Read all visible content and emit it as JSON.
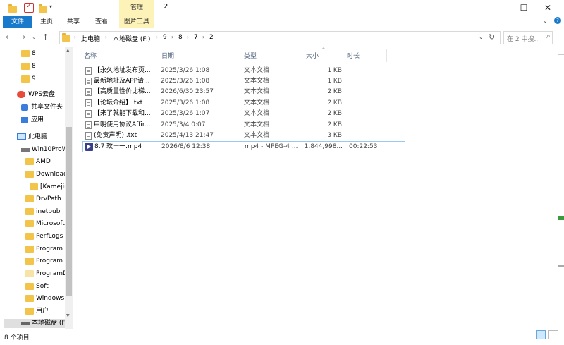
{
  "title": {
    "context_tab": "管理",
    "window_title": "2"
  },
  "window_controls": {
    "minimize": "—",
    "maximize": "☐",
    "close": "✕"
  },
  "ribbon": {
    "tabs": [
      "文件",
      "主页",
      "共享",
      "查看",
      "图片工具"
    ]
  },
  "address": {
    "crumbs": [
      "此电脑",
      "本地磁盘 (F:)",
      "9",
      "8",
      "7",
      "2"
    ],
    "search_placeholder": "在 2 中搜..."
  },
  "nav_pane": {
    "items": [
      "8",
      "8",
      "9",
      "WPS云盘",
      "共享文件夹",
      "应用",
      "此电脑",
      "Win10ProW",
      "AMD",
      "Download",
      "[Kamejin",
      "DrvPath",
      "inetpub",
      "Microsoft",
      "PerfLogs",
      "Program",
      "Program",
      "ProgramD",
      "Soft",
      "Windows",
      "用户",
      "本地磁盘 (F"
    ]
  },
  "columns": {
    "name": "名称",
    "date": "日期",
    "type": "类型",
    "size": "大小",
    "duration": "时长"
  },
  "files": [
    {
      "name": "【永久地址发布页...",
      "date": "2025/3/26 1:08",
      "type": "文本文档",
      "size": "1 KB",
      "duration": ""
    },
    {
      "name": "最新地址及APP请...",
      "date": "2025/3/26 1:08",
      "type": "文本文档",
      "size": "1 KB",
      "duration": ""
    },
    {
      "name": "【高质量性价比梯...",
      "date": "2026/6/30 23:57",
      "type": "文本文档",
      "size": "2 KB",
      "duration": ""
    },
    {
      "name": "【论坛介绍】.txt",
      "date": "2025/3/26 1:08",
      "type": "文本文档",
      "size": "2 KB",
      "duration": ""
    },
    {
      "name": "【来了就能下载和...",
      "date": "2025/3/26 1:07",
      "type": "文本文档",
      "size": "2 KB",
      "duration": ""
    },
    {
      "name": "申明使用协议Affir...",
      "date": "2025/3/4 0:07",
      "type": "文本文档",
      "size": "2 KB",
      "duration": ""
    },
    {
      "name": "(免责声明) .txt",
      "date": "2025/4/13 21:47",
      "type": "文本文档",
      "size": "3 KB",
      "duration": ""
    },
    {
      "name": "8.7  玫十一.mp4",
      "date": "2026/8/6 12:38",
      "type": "mp4 - MPEG-4 ...",
      "size": "1,844,998...",
      "duration": "00:22:53"
    }
  ],
  "status": {
    "item_count": "8 个项目"
  }
}
